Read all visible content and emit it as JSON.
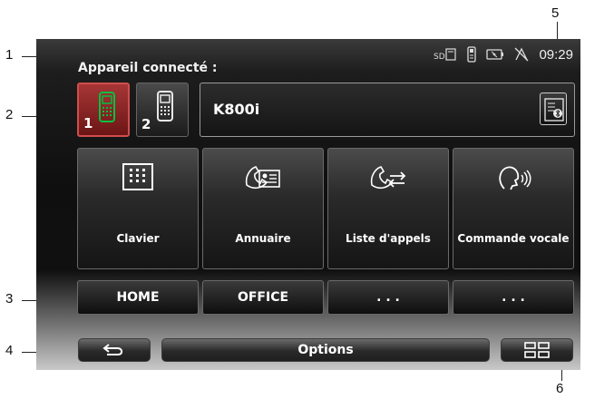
{
  "callouts": [
    "1",
    "2",
    "3",
    "4",
    "5",
    "6"
  ],
  "status_bar": {
    "icons": [
      "sd-card-icon",
      "phone-icon",
      "battery-icon",
      "no-gps-icon"
    ],
    "sd_text": "SD",
    "time": "09:29"
  },
  "connected_label": "Appareil connecté :",
  "phones": [
    {
      "number": "1",
      "state": "active",
      "color": "#00c040"
    },
    {
      "number": "2",
      "state": "inactive",
      "color": "#e8e8e8"
    }
  ],
  "device_name": "K800i",
  "main_buttons": [
    {
      "label": "Clavier",
      "icon": "keypad-icon"
    },
    {
      "label": "Annuaire",
      "icon": "phonebook-icon"
    },
    {
      "label": "Liste d'appels",
      "icon": "call-list-icon"
    },
    {
      "label": "Commande vocale",
      "icon": "voice-command-icon"
    }
  ],
  "shortcuts": [
    "HOME",
    "OFFICE",
    ". . .",
    ". . ."
  ],
  "bottom_bar": {
    "back_icon": "back-arrow-icon",
    "options_label": "Options",
    "grid_icon": "grid-menu-icon"
  }
}
